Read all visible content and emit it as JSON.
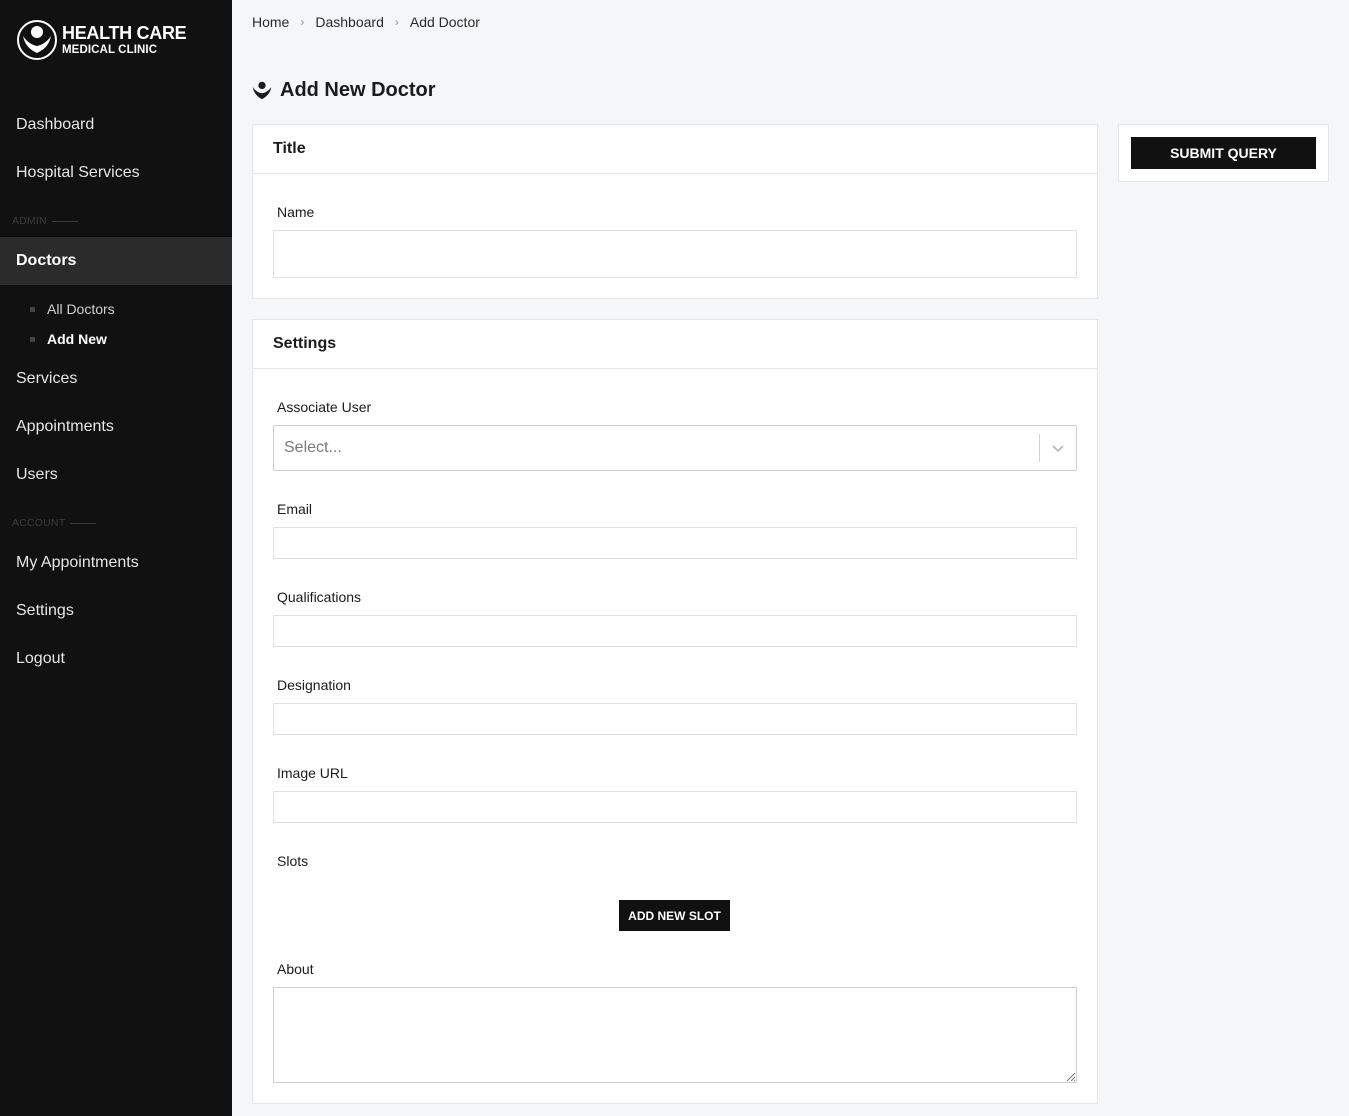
{
  "brand": {
    "line1": "HEALTH CARE",
    "line2": "MEDICAL CLINIC",
    "logo_icon": "hands-heart-icon"
  },
  "sidebar": {
    "items_top": [
      {
        "label": "Dashboard"
      },
      {
        "label": "Hospital Services"
      }
    ],
    "section_admin": "ADMIN",
    "doctors": {
      "label": "Doctors"
    },
    "doctors_sub": [
      {
        "label": "All Doctors"
      },
      {
        "label": "Add New"
      }
    ],
    "items_admin": [
      {
        "label": "Services"
      },
      {
        "label": "Appointments"
      },
      {
        "label": "Users"
      }
    ],
    "section_account": "ACCOUNT",
    "items_account": [
      {
        "label": "My Appointments"
      },
      {
        "label": "Settings"
      },
      {
        "label": "Logout"
      }
    ]
  },
  "breadcrumb": [
    "Home",
    "Dashboard",
    "Add Doctor"
  ],
  "page": {
    "title": "Add New Doctor"
  },
  "title_panel": {
    "header": "Title",
    "name_label": "Name",
    "name_value": ""
  },
  "settings_panel": {
    "header": "Settings",
    "associate_user_label": "Associate User",
    "associate_user_placeholder": "Select...",
    "email_label": "Email",
    "qualifications_label": "Qualifications",
    "designation_label": "Designation",
    "image_url_label": "Image URL",
    "slots_label": "Slots",
    "add_slot_button": "ADD NEW SLOT",
    "about_label": "About"
  },
  "submit_button": "SUBMIT QUERY",
  "colors": {
    "sidebar_bg": "#111111",
    "active_bg": "#2b2b2b",
    "page_bg": "#f5f6f8",
    "button_bg": "#111111"
  }
}
